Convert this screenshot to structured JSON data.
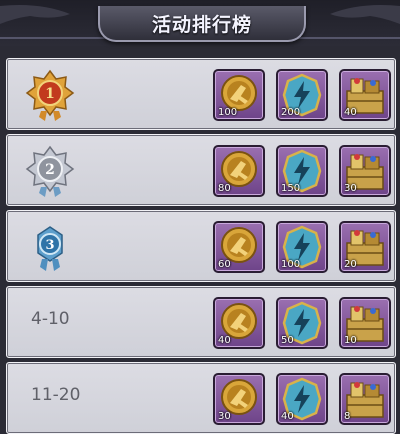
{
  "header": {
    "title": "活动排行榜"
  },
  "rows": [
    {
      "rank": "1",
      "rank_type": "gold-medal",
      "rewards": [
        "100",
        "200",
        "40"
      ]
    },
    {
      "rank": "2",
      "rank_type": "silver-medal",
      "rewards": [
        "80",
        "150",
        "30"
      ]
    },
    {
      "rank": "3",
      "rank_type": "blue-medal",
      "rewards": [
        "60",
        "100",
        "20"
      ]
    },
    {
      "rank": "4-10",
      "rank_type": "text",
      "rewards": [
        "40",
        "50",
        "10"
      ]
    },
    {
      "rank": "11-20",
      "rank_type": "text",
      "rewards": [
        "30",
        "40",
        "8"
      ]
    }
  ],
  "reward_icons": [
    "gold-token-icon",
    "energy-shield-icon",
    "treasure-chest-icon"
  ],
  "colors": {
    "gold": "#d7a83a",
    "silver": "#b8bcc6",
    "blue": "#3f86b8",
    "item_purple": "#8a5aa3"
  }
}
